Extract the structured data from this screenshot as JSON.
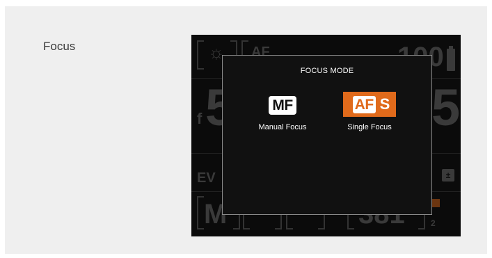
{
  "section": {
    "title": "Focus"
  },
  "dialog": {
    "title": "FOCUS MODE",
    "options": [
      {
        "badge": "MF",
        "label": "Manual Focus",
        "selected": false
      },
      {
        "badge": "AF",
        "suffix": "S",
        "label": "Single Focus",
        "selected": true
      }
    ]
  },
  "background_lcd": {
    "top_value": "100",
    "aperture_prefix": "f",
    "aperture_digit": "5",
    "shutter_digit": "5",
    "ev_label": "EV",
    "ev_icon": "exposure-compensation-icon",
    "af_fragment": "AF",
    "mode_letter": "M",
    "shots_fragment": "381",
    "subscript": "2",
    "brightness_icon": "sun-icon",
    "battery_icon": "battery-icon"
  },
  "colors": {
    "accent": "#e06a1b",
    "dialog_bg": "#111111",
    "dialog_border": "#8a8a8a",
    "panel_bg": "#efefef",
    "lcd_dim": "#3a3a3a"
  }
}
